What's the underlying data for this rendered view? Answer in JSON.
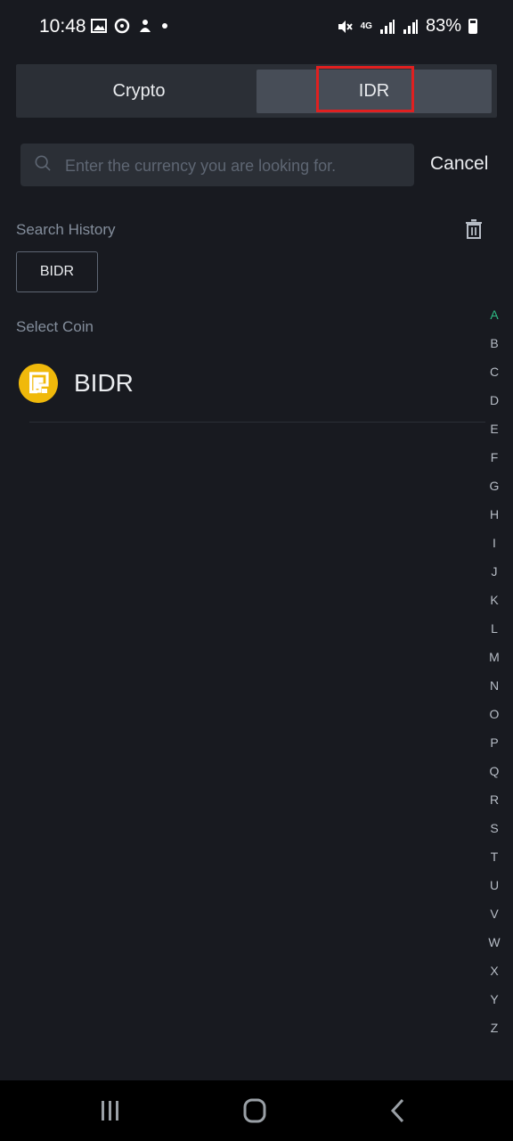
{
  "status_bar": {
    "time": "10:48",
    "battery": "83%",
    "network": "4G"
  },
  "segment": {
    "tabs": [
      {
        "label": "Crypto",
        "selected": false
      },
      {
        "label": "IDR",
        "selected": true
      }
    ]
  },
  "search": {
    "placeholder": "Enter the currency you are looking for.",
    "value": "",
    "cancel_label": "Cancel"
  },
  "search_history": {
    "title": "Search History",
    "items": [
      "BIDR"
    ]
  },
  "select_coin": {
    "title": "Select Coin",
    "coins": [
      {
        "name": "BIDR",
        "icon": "bidr-coin-icon",
        "color": "#f0b90b"
      }
    ]
  },
  "alphabet": {
    "letters": [
      "A",
      "B",
      "C",
      "D",
      "E",
      "F",
      "G",
      "H",
      "I",
      "J",
      "K",
      "L",
      "M",
      "N",
      "O",
      "P",
      "Q",
      "R",
      "S",
      "T",
      "U",
      "V",
      "W",
      "X",
      "Y",
      "Z"
    ],
    "active": "A",
    "active_color": "#2ebd85"
  },
  "colors": {
    "background": "#181a20",
    "surface": "#2b2f36",
    "selected_tab": "#474d57",
    "highlight": "#e02020",
    "brand_yellow": "#f0b90b"
  }
}
